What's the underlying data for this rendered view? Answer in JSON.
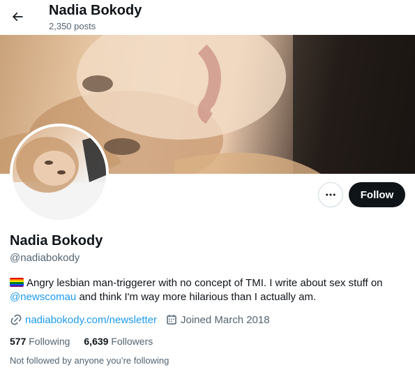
{
  "header": {
    "name": "Nadia Bokody",
    "posts_count": "2,350 posts"
  },
  "profile": {
    "display_name": "Nadia Bokody",
    "handle": "@nadiabokody",
    "follow_label": "Follow",
    "bio_emoji_icon": "rainbow-flag-icon",
    "bio_text_1": "Angry lesbian man-triggerer with no concept of TMI. I write about sex stuff on",
    "bio_mention": "@newscomau",
    "bio_text_2": "and think I'm way more hilarious than I actually am.",
    "website": "nadiabokody.com/newsletter",
    "joined": "Joined March 2018",
    "following_count": "577",
    "following_label": "Following",
    "followers_count": "6,639",
    "followers_label": "Followers",
    "not_followed_text": "Not followed by anyone you’re following"
  },
  "colors": {
    "accent": "#1d9bf0",
    "text": "#0f1419",
    "muted": "#536471",
    "button_dark": "#0f1419"
  },
  "icons": {
    "back": "arrow-left-icon",
    "more": "more-horizontal-icon",
    "link": "link-icon",
    "calendar": "calendar-icon"
  }
}
